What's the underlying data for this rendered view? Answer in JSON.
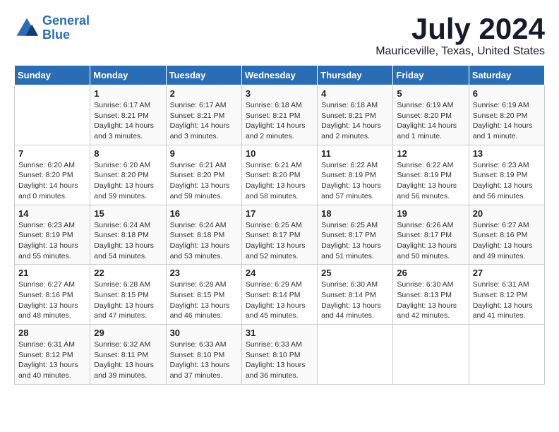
{
  "header": {
    "logo_line1": "General",
    "logo_line2": "Blue",
    "month": "July 2024",
    "location": "Mauriceville, Texas, United States"
  },
  "days_of_week": [
    "Sunday",
    "Monday",
    "Tuesday",
    "Wednesday",
    "Thursday",
    "Friday",
    "Saturday"
  ],
  "weeks": [
    [
      {
        "day": "",
        "info": ""
      },
      {
        "day": "1",
        "info": "Sunrise: 6:17 AM\nSunset: 8:21 PM\nDaylight: 14 hours\nand 3 minutes."
      },
      {
        "day": "2",
        "info": "Sunrise: 6:17 AM\nSunset: 8:21 PM\nDaylight: 14 hours\nand 3 minutes."
      },
      {
        "day": "3",
        "info": "Sunrise: 6:18 AM\nSunset: 8:21 PM\nDaylight: 14 hours\nand 2 minutes."
      },
      {
        "day": "4",
        "info": "Sunrise: 6:18 AM\nSunset: 8:21 PM\nDaylight: 14 hours\nand 2 minutes."
      },
      {
        "day": "5",
        "info": "Sunrise: 6:19 AM\nSunset: 8:20 PM\nDaylight: 14 hours\nand 1 minute."
      },
      {
        "day": "6",
        "info": "Sunrise: 6:19 AM\nSunset: 8:20 PM\nDaylight: 14 hours\nand 1 minute."
      }
    ],
    [
      {
        "day": "7",
        "info": "Sunrise: 6:20 AM\nSunset: 8:20 PM\nDaylight: 14 hours\nand 0 minutes."
      },
      {
        "day": "8",
        "info": "Sunrise: 6:20 AM\nSunset: 8:20 PM\nDaylight: 13 hours\nand 59 minutes."
      },
      {
        "day": "9",
        "info": "Sunrise: 6:21 AM\nSunset: 8:20 PM\nDaylight: 13 hours\nand 59 minutes."
      },
      {
        "day": "10",
        "info": "Sunrise: 6:21 AM\nSunset: 8:20 PM\nDaylight: 13 hours\nand 58 minutes."
      },
      {
        "day": "11",
        "info": "Sunrise: 6:22 AM\nSunset: 8:19 PM\nDaylight: 13 hours\nand 57 minutes."
      },
      {
        "day": "12",
        "info": "Sunrise: 6:22 AM\nSunset: 8:19 PM\nDaylight: 13 hours\nand 56 minutes."
      },
      {
        "day": "13",
        "info": "Sunrise: 6:23 AM\nSunset: 8:19 PM\nDaylight: 13 hours\nand 56 minutes."
      }
    ],
    [
      {
        "day": "14",
        "info": "Sunrise: 6:23 AM\nSunset: 8:19 PM\nDaylight: 13 hours\nand 55 minutes."
      },
      {
        "day": "15",
        "info": "Sunrise: 6:24 AM\nSunset: 8:18 PM\nDaylight: 13 hours\nand 54 minutes."
      },
      {
        "day": "16",
        "info": "Sunrise: 6:24 AM\nSunset: 8:18 PM\nDaylight: 13 hours\nand 53 minutes."
      },
      {
        "day": "17",
        "info": "Sunrise: 6:25 AM\nSunset: 8:17 PM\nDaylight: 13 hours\nand 52 minutes."
      },
      {
        "day": "18",
        "info": "Sunrise: 6:25 AM\nSunset: 8:17 PM\nDaylight: 13 hours\nand 51 minutes."
      },
      {
        "day": "19",
        "info": "Sunrise: 6:26 AM\nSunset: 8:17 PM\nDaylight: 13 hours\nand 50 minutes."
      },
      {
        "day": "20",
        "info": "Sunrise: 6:27 AM\nSunset: 8:16 PM\nDaylight: 13 hours\nand 49 minutes."
      }
    ],
    [
      {
        "day": "21",
        "info": "Sunrise: 6:27 AM\nSunset: 8:16 PM\nDaylight: 13 hours\nand 48 minutes."
      },
      {
        "day": "22",
        "info": "Sunrise: 6:28 AM\nSunset: 8:15 PM\nDaylight: 13 hours\nand 47 minutes."
      },
      {
        "day": "23",
        "info": "Sunrise: 6:28 AM\nSunset: 8:15 PM\nDaylight: 13 hours\nand 46 minutes."
      },
      {
        "day": "24",
        "info": "Sunrise: 6:29 AM\nSunset: 8:14 PM\nDaylight: 13 hours\nand 45 minutes."
      },
      {
        "day": "25",
        "info": "Sunrise: 6:30 AM\nSunset: 8:14 PM\nDaylight: 13 hours\nand 44 minutes."
      },
      {
        "day": "26",
        "info": "Sunrise: 6:30 AM\nSunset: 8:13 PM\nDaylight: 13 hours\nand 42 minutes."
      },
      {
        "day": "27",
        "info": "Sunrise: 6:31 AM\nSunset: 8:12 PM\nDaylight: 13 hours\nand 41 minutes."
      }
    ],
    [
      {
        "day": "28",
        "info": "Sunrise: 6:31 AM\nSunset: 8:12 PM\nDaylight: 13 hours\nand 40 minutes."
      },
      {
        "day": "29",
        "info": "Sunrise: 6:32 AM\nSunset: 8:11 PM\nDaylight: 13 hours\nand 39 minutes."
      },
      {
        "day": "30",
        "info": "Sunrise: 6:33 AM\nSunset: 8:10 PM\nDaylight: 13 hours\nand 37 minutes."
      },
      {
        "day": "31",
        "info": "Sunrise: 6:33 AM\nSunset: 8:10 PM\nDaylight: 13 hours\nand 36 minutes."
      },
      {
        "day": "",
        "info": ""
      },
      {
        "day": "",
        "info": ""
      },
      {
        "day": "",
        "info": ""
      }
    ]
  ]
}
